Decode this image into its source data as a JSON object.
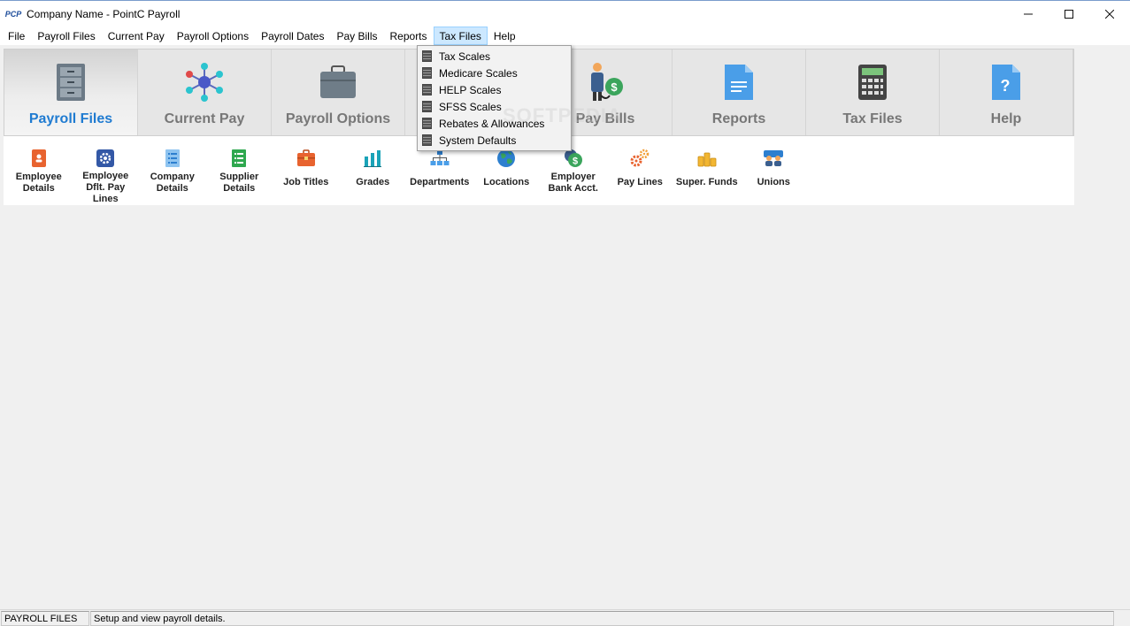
{
  "window": {
    "logo": "PCP",
    "title": "Company Name - PointC Payroll",
    "controls": {
      "minimize": "─",
      "maximize": "☐",
      "close": "✕"
    }
  },
  "menu": {
    "items": [
      "File",
      "Payroll Files",
      "Current Pay",
      "Payroll Options",
      "Payroll Dates",
      "Pay Bills",
      "Reports",
      "Tax Files",
      "Help"
    ],
    "active": "Tax Files"
  },
  "big_toolbar": {
    "tabs": [
      {
        "label": "Payroll Files",
        "icon": "filing-cabinet-icon",
        "selected": true
      },
      {
        "label": "Current Pay",
        "icon": "network-nodes-icon",
        "selected": false
      },
      {
        "label": "Payroll Options",
        "icon": "briefcase-icon",
        "selected": false
      },
      {
        "label": "",
        "icon": "hidden",
        "selected": false
      },
      {
        "label": "Pay Bills",
        "icon": "person-dollar-icon",
        "selected": false
      },
      {
        "label": "Reports",
        "icon": "document-icon",
        "selected": false
      },
      {
        "label": "Tax Files",
        "icon": "calculator-icon",
        "selected": false
      },
      {
        "label": "Help",
        "icon": "help-document-icon",
        "selected": false
      }
    ]
  },
  "sub_toolbar": {
    "items": [
      {
        "label": "Employee\nDetails",
        "icon": "contact-book-icon"
      },
      {
        "label": "Employee\nDflt. Pay Lines",
        "icon": "gear-settings-icon"
      },
      {
        "label": "Company\nDetails",
        "icon": "list-document-icon"
      },
      {
        "label": "Supplier\nDetails",
        "icon": "green-list-icon"
      },
      {
        "label": "Job Titles",
        "icon": "briefcase-icon"
      },
      {
        "label": "Grades",
        "icon": "bar-chart-icon"
      },
      {
        "label": "Departments",
        "icon": "org-chart-icon"
      },
      {
        "label": "Locations",
        "icon": "globe-icon"
      },
      {
        "label": "Employer\nBank Acct.",
        "icon": "bank-dollar-icon"
      },
      {
        "label": "Pay Lines",
        "icon": "gears-icon"
      },
      {
        "label": "Super. Funds",
        "icon": "coins-icon"
      },
      {
        "label": "Unions",
        "icon": "people-icon"
      }
    ]
  },
  "dropdown": {
    "items": [
      "Tax Scales",
      "Medicare Scales",
      "HELP Scales",
      "SFSS Scales",
      "Rebates & Allowances",
      "System Defaults"
    ]
  },
  "watermark": "SOFTPEDIA",
  "status": {
    "section": "PAYROLL FILES",
    "message": "Setup and view payroll details."
  },
  "colors": {
    "accent_blue": "#1f7bd1",
    "menu_highlight": "#cce8ff"
  }
}
